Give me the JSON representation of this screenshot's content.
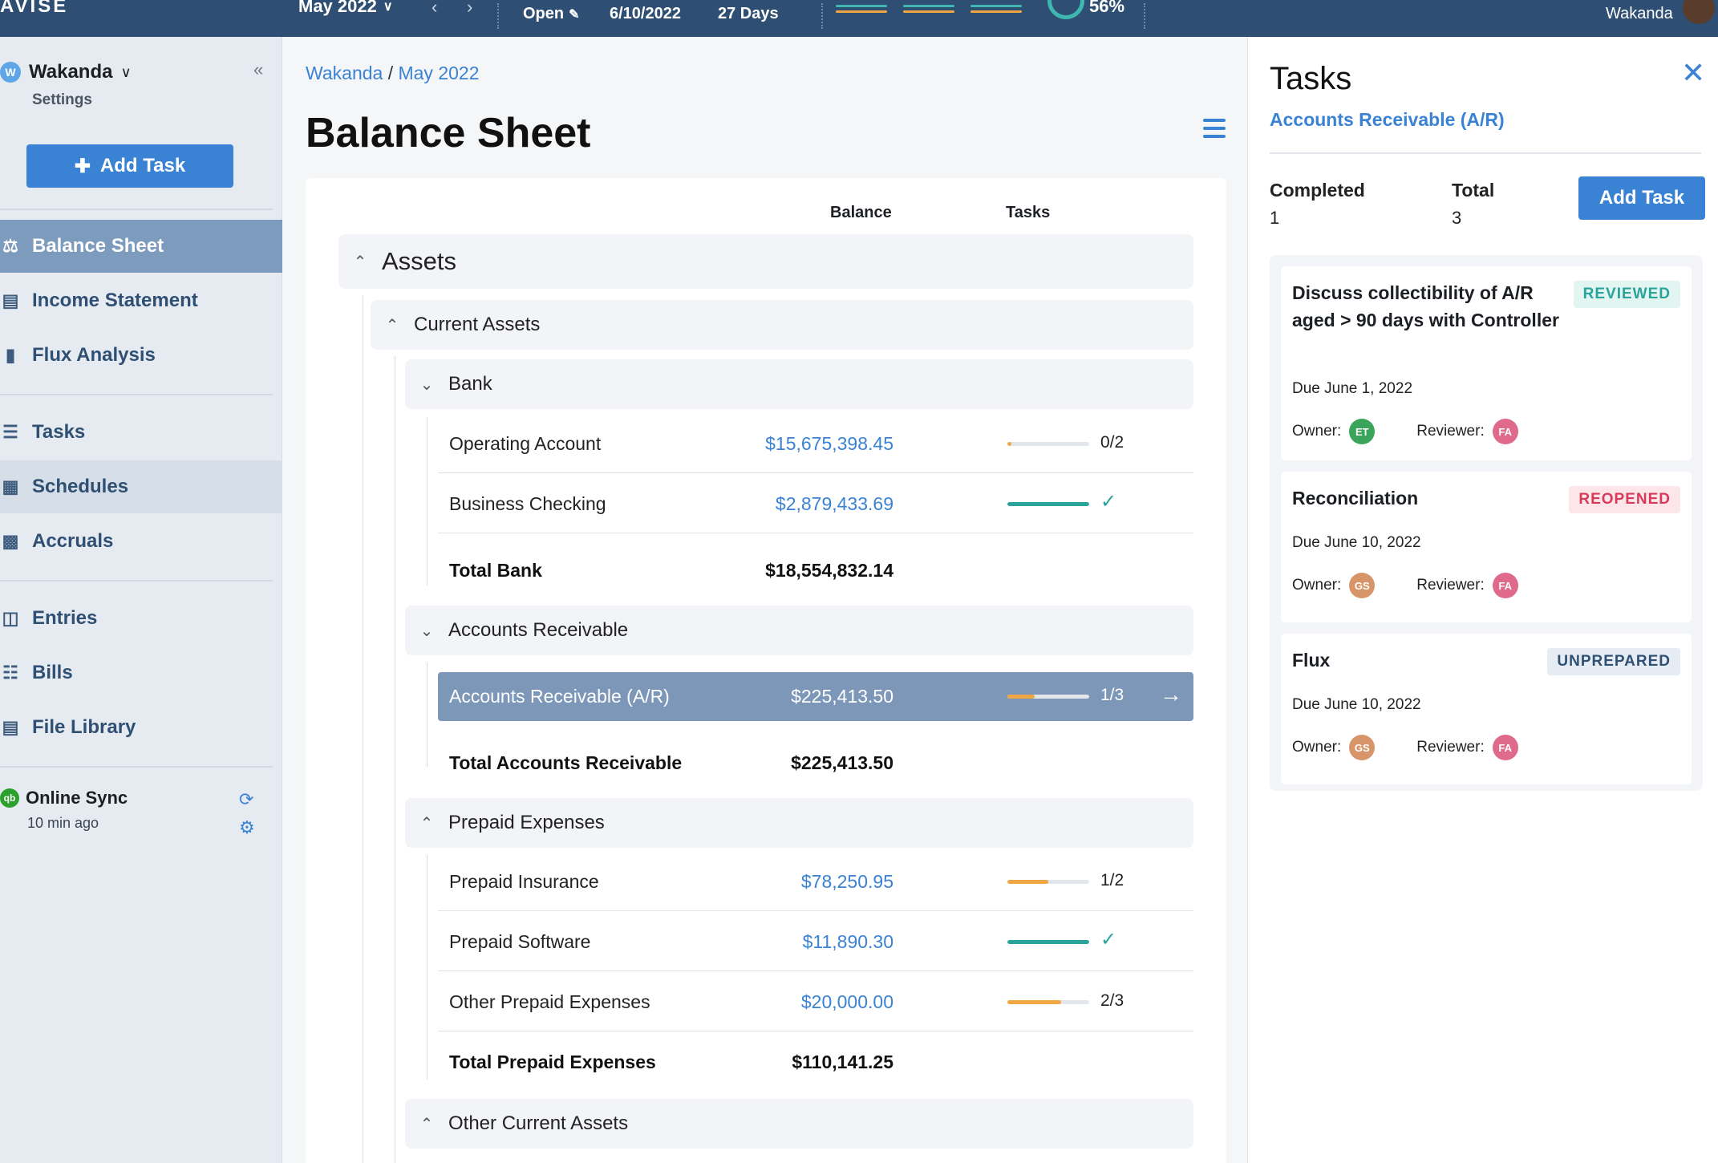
{
  "topbar": {
    "brand": "AVISE",
    "period": "May 2022",
    "status": "Open",
    "date": "6/10/2022",
    "days": "27 Days",
    "percent": "56%",
    "user": "Wakanda",
    "bar_colors": [
      "#3fb6b0",
      "#f0a742",
      "#cfd9e6"
    ]
  },
  "sidebar": {
    "org_badge": "W",
    "org_name": "Wakanda",
    "settings": "Settings",
    "add_task": "Add Task",
    "items": [
      {
        "label": "Balance Sheet",
        "icon": "scale-icon"
      },
      {
        "label": "Income Statement",
        "icon": "statement-icon"
      },
      {
        "label": "Flux Analysis",
        "icon": "bar-chart-icon"
      },
      {
        "label": "Tasks",
        "icon": "checklist-icon"
      },
      {
        "label": "Schedules",
        "icon": "calendar-icon"
      },
      {
        "label": "Accruals",
        "icon": "accruals-icon"
      },
      {
        "label": "Entries",
        "icon": "ledger-icon"
      },
      {
        "label": "Bills",
        "icon": "receipt-icon"
      },
      {
        "label": "File Library",
        "icon": "document-icon"
      }
    ],
    "sync": {
      "badge": "qb",
      "title": "Online Sync",
      "subtitle": "10 min ago"
    }
  },
  "main": {
    "breadcrumb": {
      "org": "Wakanda",
      "sep": "/",
      "period": "May 2022"
    },
    "title": "Balance Sheet",
    "columns": {
      "balance": "Balance",
      "tasks": "Tasks"
    },
    "assets_label": "Assets",
    "current_assets_label": "Current Assets",
    "bank": {
      "label": "Bank",
      "rows": [
        {
          "label": "Operating Account",
          "amount": "$15,675,398.45",
          "tasks": "0/2",
          "progress": 0.05
        },
        {
          "label": "Business Checking",
          "amount": "$2,879,433.69",
          "tasks": "✓",
          "progress": 1.0
        }
      ],
      "total_label": "Total Bank",
      "total_amount": "$18,554,832.14"
    },
    "ar": {
      "label": "Accounts Receivable",
      "rows": [
        {
          "label": "Accounts Receivable (A/R)",
          "amount": "$225,413.50",
          "tasks": "1/3",
          "progress": 0.33
        }
      ],
      "total_label": "Total Accounts Receivable",
      "total_amount": "$225,413.50"
    },
    "prepaid": {
      "label": "Prepaid Expenses",
      "rows": [
        {
          "label": "Prepaid Insurance",
          "amount": "$78,250.95",
          "tasks": "1/2",
          "progress": 0.5
        },
        {
          "label": "Prepaid Software",
          "amount": "$11,890.30",
          "tasks": "✓",
          "progress": 1.0
        },
        {
          "label": "Other Prepaid Expenses",
          "amount": "$20,000.00",
          "tasks": "2/3",
          "progress": 0.66
        }
      ],
      "total_label": "Total Prepaid Expenses",
      "total_amount": "$110,141.25"
    },
    "other_current_label": "Other Current Assets"
  },
  "panel": {
    "title": "Tasks",
    "subtitle": "Accounts Receivable (A/R)",
    "completed_label": "Completed",
    "completed_value": "1",
    "total_label": "Total",
    "total_value": "3",
    "add_task": "Add Task",
    "owner_label": "Owner:",
    "reviewer_label": "Reviewer:",
    "cards": [
      {
        "title": "Discuss collectibility of A/R aged > 90 days with Controller",
        "status": "REVIEWED",
        "due": "Due June 1, 2022",
        "owner": "ET",
        "owner_color": "#3aa55a",
        "reviewer": "FA",
        "reviewer_color": "#e06a8c"
      },
      {
        "title": "Reconciliation",
        "status": "REOPENED",
        "due": "Due June 10, 2022",
        "owner": "GS",
        "owner_color": "#d9956a",
        "reviewer": "FA",
        "reviewer_color": "#e06a8c"
      },
      {
        "title": "Flux",
        "status": "UNPREPARED",
        "due": "Due June 10, 2022",
        "owner": "GS",
        "owner_color": "#d9956a",
        "reviewer": "FA",
        "reviewer_color": "#e06a8c"
      }
    ]
  }
}
